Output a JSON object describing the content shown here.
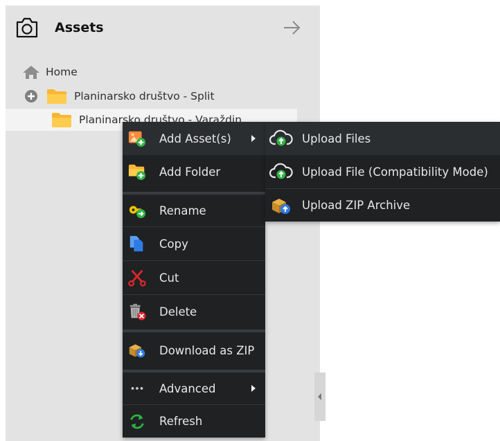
{
  "panel": {
    "title": "Assets"
  },
  "tree": {
    "items": [
      {
        "label": "Home"
      },
      {
        "label": "Planinarsko društvo - Split"
      },
      {
        "label": "Planinarsko društvo - Varaždin"
      }
    ]
  },
  "context_menu": {
    "items": [
      {
        "label": "Add Asset(s)",
        "icon": "add-asset-icon",
        "has_submenu": true
      },
      {
        "label": "Add Folder",
        "icon": "add-folder-icon"
      },
      {
        "label": "Rename",
        "icon": "rename-key-icon"
      },
      {
        "label": "Copy",
        "icon": "copy-icon"
      },
      {
        "label": "Cut",
        "icon": "cut-scissors-icon"
      },
      {
        "label": "Delete",
        "icon": "delete-trash-icon"
      },
      {
        "label": "Download as ZIP",
        "icon": "download-zip-icon"
      },
      {
        "label": "Advanced",
        "icon": "ellipsis-icon",
        "has_submenu": true
      },
      {
        "label": "Refresh",
        "icon": "refresh-icon"
      }
    ]
  },
  "submenu": {
    "items": [
      {
        "label": "Upload Files",
        "icon": "cloud-upload-icon"
      },
      {
        "label": "Upload File (Compatibility Mode)",
        "icon": "cloud-upload-outline-icon"
      },
      {
        "label": "Upload ZIP Archive",
        "icon": "upload-zip-box-icon"
      }
    ]
  },
  "colors": {
    "panel_bg": "#e3e3e4",
    "menu_bg": "#1f2123",
    "menu_text": "#e8e8e8",
    "folder": "#ffcc4d",
    "green": "#2fb344",
    "blue": "#2f7be6",
    "red": "#e0262b"
  }
}
